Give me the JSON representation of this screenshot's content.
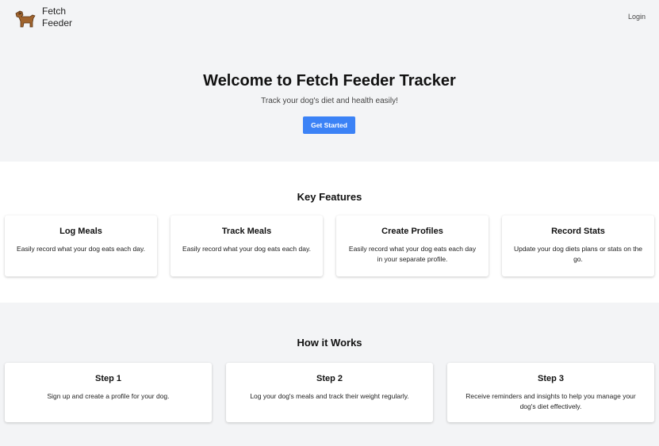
{
  "header": {
    "brand_line1": "Fetch",
    "brand_line2": "Feeder",
    "logo_icon": "dog-icon",
    "login_label": "Login"
  },
  "hero": {
    "title": "Welcome to Fetch Feeder Tracker",
    "subtitle": "Track your dog's diet and health easily!",
    "cta_label": "Get Started"
  },
  "features": {
    "title": "Key Features",
    "items": [
      {
        "title": "Log Meals",
        "text": "Easily record what your dog eats each day."
      },
      {
        "title": "Track Meals",
        "text": "Easily record what your dog eats each day."
      },
      {
        "title": "Create Profiles",
        "text": "Easily record what your dog eats each day in your separate profile."
      },
      {
        "title": "Record Stats",
        "text": "Update your dog diets plans or stats on the go."
      }
    ]
  },
  "how": {
    "title": "How it Works",
    "steps": [
      {
        "title": "Step 1",
        "text": "Sign up and create a profile for your dog."
      },
      {
        "title": "Step 2",
        "text": "Log your dog's meals and track their weight regularly."
      },
      {
        "title": "Step 3",
        "text": "Receive reminders and insights to help you manage your dog's diet effectively."
      }
    ]
  },
  "colors": {
    "accent": "#3b82f6",
    "background": "#f3f4f6",
    "section_white": "#ffffff"
  }
}
